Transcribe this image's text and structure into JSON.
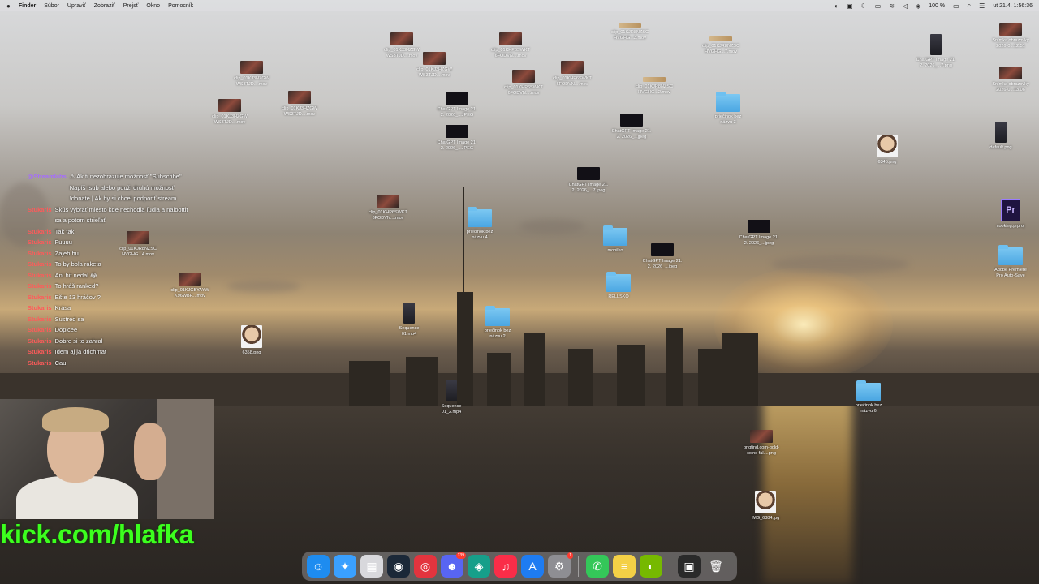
{
  "menubar": {
    "apple": "",
    "items": [
      "Finder",
      "Súbor",
      "Upraviť",
      "Zobraziť",
      "Prejsť",
      "Okno",
      "Pomocník"
    ],
    "battery": "100 %",
    "datetime": "ut 21.4.  1:56:36"
  },
  "desktop_icons": [
    {
      "label": "clip_01KJ3HZGW\nWS3TJD....mov",
      "kind": "vid"
    },
    {
      "label": "clip_01KJ3HZGW\nWS3TJD....mov",
      "kind": "vid"
    },
    {
      "label": "clip_01KJ3HZGW\nWS3TJD....mov",
      "kind": "vid"
    },
    {
      "label": "clip_01KJ3HZGW\nWS3TJD....mov",
      "kind": "vid"
    },
    {
      "label": "clip_01KJ3HZGW\nWS3TJD....mov",
      "kind": "vid"
    },
    {
      "label": "clip_01KHP6SWKT\n6FODVN....mov",
      "kind": "vid"
    },
    {
      "label": "clip_01KHP6SWKT\n6FODVN....mov",
      "kind": "vid"
    },
    {
      "label": "clip_01KHP6SWKT\n6FODVN....mov",
      "kind": "vid"
    },
    {
      "label": "clip_01KHP6SWKT\n6FODVN....mov",
      "kind": "vid"
    },
    {
      "label": "clip_01KJR8NZSC\nHVGHG...3.mov",
      "kind": "strip"
    },
    {
      "label": "clip_01KJR8NZSC\nHVGHG...7.mov",
      "kind": "strip"
    },
    {
      "label": "clip_01KJR8NZSC\nHVGHG...2.mov",
      "kind": "strip"
    },
    {
      "label": "clip_01KJR8NZSC\nHVGHG...4.mov",
      "kind": "vid"
    },
    {
      "label": "ChatGPT Image 21.\n2. 2026_...JPEG",
      "kind": "dark"
    },
    {
      "label": "ChatGPT Image 21.\n2. 2026_...JPEG",
      "kind": "dark"
    },
    {
      "label": "ChatGPT Image 21.\n2. 2026_...jpeg",
      "kind": "dark"
    },
    {
      "label": "ChatGPT Image 21.\n2. 2026_...7.jpeg",
      "kind": "dark"
    },
    {
      "label": "ChatGPT Image 21.\n2. 2026_...jpeg",
      "kind": "dark"
    },
    {
      "label": "ChatGPT Image 21.\n2. 2026_...jpeg",
      "kind": "dark"
    },
    {
      "label": "ChatGPT Image 21.\n2. 2026_...7.png",
      "kind": "phone"
    },
    {
      "label": "priečinok bez\nnázvu 3",
      "kind": "folder"
    },
    {
      "label": "priečinok bez\nnázvu 4",
      "kind": "folder"
    },
    {
      "label": "priečinok bez\nnázvu 2",
      "kind": "folder"
    },
    {
      "label": "priečinok bez\nnázvu 6",
      "kind": "folder"
    },
    {
      "label": "mobilko",
      "kind": "folder"
    },
    {
      "label": "RELLSKO",
      "kind": "folder"
    },
    {
      "label": "Sequence\n01.mp4",
      "kind": "phone"
    },
    {
      "label": "Sequence\n01_2.mp4",
      "kind": "phone"
    },
    {
      "label": "6345.png",
      "kind": "face"
    },
    {
      "label": "6358.png",
      "kind": "face"
    },
    {
      "label": "clip_01KJGBYAYW\nK96WBF....mov",
      "kind": "vid"
    },
    {
      "label": "Snímka obrazovky\n2026-0...12.51",
      "kind": "vid"
    },
    {
      "label": "Snímka obrazovky\n2026-0...13.06",
      "kind": "vid"
    },
    {
      "label": "default.png",
      "kind": "phone"
    },
    {
      "label": "cooking.prproj",
      "kind": "pr"
    },
    {
      "label": "Adobe Premiere\nPro Auto-Save",
      "kind": "folder"
    },
    {
      "label": "pngfind.com-gold-\ncoins-fal....png",
      "kind": "vid"
    },
    {
      "label": "IMG_6384.jpg",
      "kind": "face"
    }
  ],
  "chat": [
    {
      "user": "@Streamlabs",
      "msg": "⚠ Ak ti nezobrazuje možnosť \"Subscribe\" Napíš !sub alebo použi druhú možnosť !donate | Ak by si chcel podporiť stream",
      "purple": true
    },
    {
      "user": "Stukaris",
      "msg": "Skús vybrať miesto kde nechodia ľudia a naloottit sa a potom strieľať"
    },
    {
      "user": "Stukaris",
      "msg": "Tak tak"
    },
    {
      "user": "Stukaris",
      "msg": "Fuuuu"
    },
    {
      "user": "Stukaris",
      "msg": "Zajeb hu"
    },
    {
      "user": "Stukaris",
      "msg": "To by bola raketa"
    },
    {
      "user": "Stukaris",
      "msg": "Ani hit nedal 😂"
    },
    {
      "user": "Stukaris",
      "msg": "To hráš ranked?"
    },
    {
      "user": "Stukaris",
      "msg": "Ešte 13 hráčov ?"
    },
    {
      "user": "Stukaris",
      "msg": "Krása"
    },
    {
      "user": "Stukaris",
      "msg": "Sustred sa"
    },
    {
      "user": "Stukaris",
      "msg": "Dopicee"
    },
    {
      "user": "Stukaris",
      "msg": "Dobre si to zahral"
    },
    {
      "user": "Stukaris",
      "msg": "Idem aj ja drichmat"
    },
    {
      "user": "Stukaris",
      "msg": "Cau"
    }
  ],
  "overlay": {
    "kick_url": "kick.com/hlafka"
  },
  "dock": [
    {
      "name": "finder-icon",
      "glyph": "☺",
      "bg": "#1e8cf0"
    },
    {
      "name": "safari-icon",
      "glyph": "✦",
      "bg": "#3aa0ff"
    },
    {
      "name": "launchpad-icon",
      "glyph": "▦",
      "bg": "#d8d8dc"
    },
    {
      "name": "steam-icon",
      "glyph": "◉",
      "bg": "#1b2838"
    },
    {
      "name": "opera-icon",
      "glyph": "◎",
      "bg": "#e3343e"
    },
    {
      "name": "discord-icon",
      "glyph": "☻",
      "bg": "#5865f2",
      "badge": "139"
    },
    {
      "name": "chatgpt-icon",
      "glyph": "◈",
      "bg": "#169f8a"
    },
    {
      "name": "music-icon",
      "glyph": "♫",
      "bg": "#fa2d48"
    },
    {
      "name": "appstore-icon",
      "glyph": "A",
      "bg": "#1e7cf2"
    },
    {
      "name": "settings-icon",
      "glyph": "⚙",
      "bg": "#8e8e93",
      "badge": "1"
    },
    {
      "name": "phone-icon",
      "glyph": "✆",
      "bg": "#34c759"
    },
    {
      "name": "notes-icon",
      "glyph": "≡",
      "bg": "#f4d046"
    },
    {
      "name": "nvidia-icon",
      "glyph": "◐",
      "bg": "#76b900"
    },
    {
      "name": "gpu-app-icon",
      "glyph": "▣",
      "bg": "#2a2a2a"
    },
    {
      "name": "trash-icon",
      "glyph": "🗑",
      "bg": "rgba(255,255,255,0.0)"
    }
  ]
}
